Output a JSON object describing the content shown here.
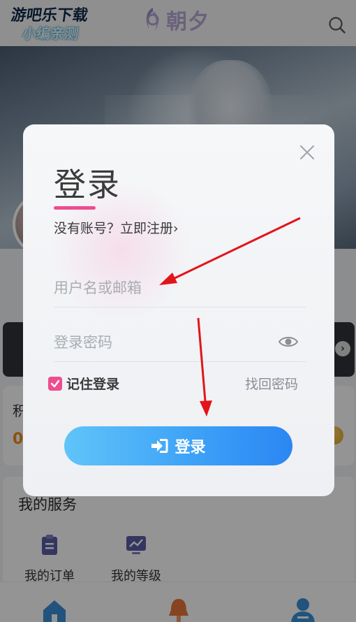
{
  "header": {
    "watermark_line1": "游吧乐下载",
    "watermark_line2": "小编亲测",
    "logo_text": "朝夕",
    "search_icon": "search-icon"
  },
  "profile": {
    "points_label": "积",
    "points_value": "0",
    "service_title": "我的服务",
    "services": [
      {
        "label": "我的订单",
        "icon": "clipboard-icon",
        "color": "#5b5ea6"
      },
      {
        "label": "我的等级",
        "icon": "chart-monitor-icon",
        "color": "#5b5ea6"
      }
    ],
    "tabs": [
      {
        "icon": "home-icon",
        "color": "#3a8fd8"
      },
      {
        "icon": "bell-icon",
        "color": "#e8763a"
      },
      {
        "icon": "user-icon",
        "color": "#3a8fd8"
      }
    ]
  },
  "login_modal": {
    "title": "登录",
    "register_prompt": "没有账号？立即注册",
    "register_chevron": "›",
    "username_placeholder": "用户名或邮箱",
    "username_value": "",
    "password_placeholder": "登录密码",
    "password_value": "",
    "remember_label": "记住登录",
    "remember_checked": true,
    "forgot_label": "找回密码",
    "submit_label": "登录",
    "accent_color": "#ee4d8f",
    "button_gradient": [
      "#60c4f9",
      "#2b86f3"
    ]
  },
  "annotations": {
    "arrow_color": "#e3141a"
  }
}
